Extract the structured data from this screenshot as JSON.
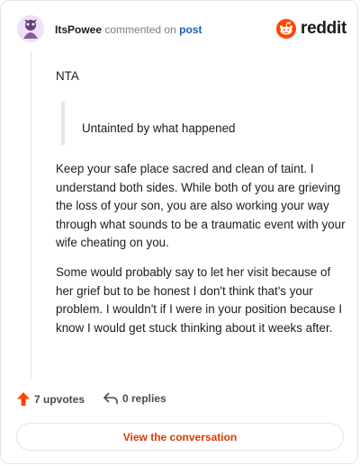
{
  "header": {
    "username": "ItsPowee",
    "verb": "commented on",
    "target": "post",
    "brand": "reddit"
  },
  "comment": {
    "line1": "NTA",
    "quote": "Untainted by what happened",
    "paragraph1": "Keep your safe place sacred and clean of taint. I understand both sides. While both of you are grieving the loss of your son, you are also working your way through what sounds to be a traumatic event with your wife cheating on you.",
    "paragraph2": "Some would probably say to let her visit because of her grief but to be honest I don't think that's your problem. I wouldn't if I were in your position because I know I would get stuck thinking about it weeks after."
  },
  "actions": {
    "upvotes": "7 upvotes",
    "replies": "0 replies",
    "upvote_icon": "arrow-up-icon",
    "reply_icon": "reply-arrow-icon"
  },
  "cta": {
    "label": "View the conversation"
  },
  "colors": {
    "brand": "#ff4500",
    "link": "#1a5cb0",
    "cta_text": "#d93a00",
    "border": "#e4e6e8"
  }
}
